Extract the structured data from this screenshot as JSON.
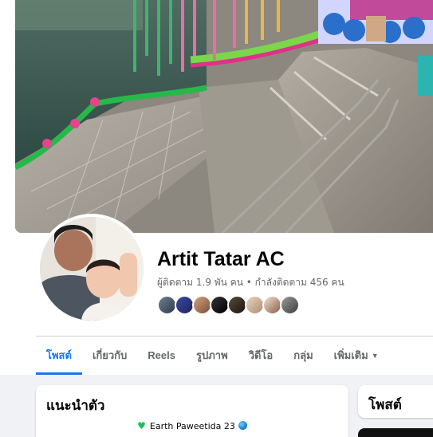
{
  "profile": {
    "name": "Artit Tatar AC",
    "stats": "ผู้ติดตาม 1.9 พัน คน • กำลังติดตาม 456 คน"
  },
  "tabs": [
    {
      "label": "โพสต์",
      "active": true
    },
    {
      "label": "เกี่ยวกับ",
      "active": false
    },
    {
      "label": "Reels",
      "active": false
    },
    {
      "label": "รูปภาพ",
      "active": false
    },
    {
      "label": "วิดีโอ",
      "active": false
    },
    {
      "label": "กลุ่ม",
      "active": false
    },
    {
      "label": "เพิ่มเติม",
      "active": false
    }
  ],
  "intro": {
    "title": "แนะนำตัว",
    "bio": "Earth Paweetida 23"
  },
  "posts": {
    "title": "โพสต์"
  },
  "colors": {
    "accent": "#1877f2",
    "secondary_text": "#65676b",
    "page_bg": "#f0f2f5"
  }
}
